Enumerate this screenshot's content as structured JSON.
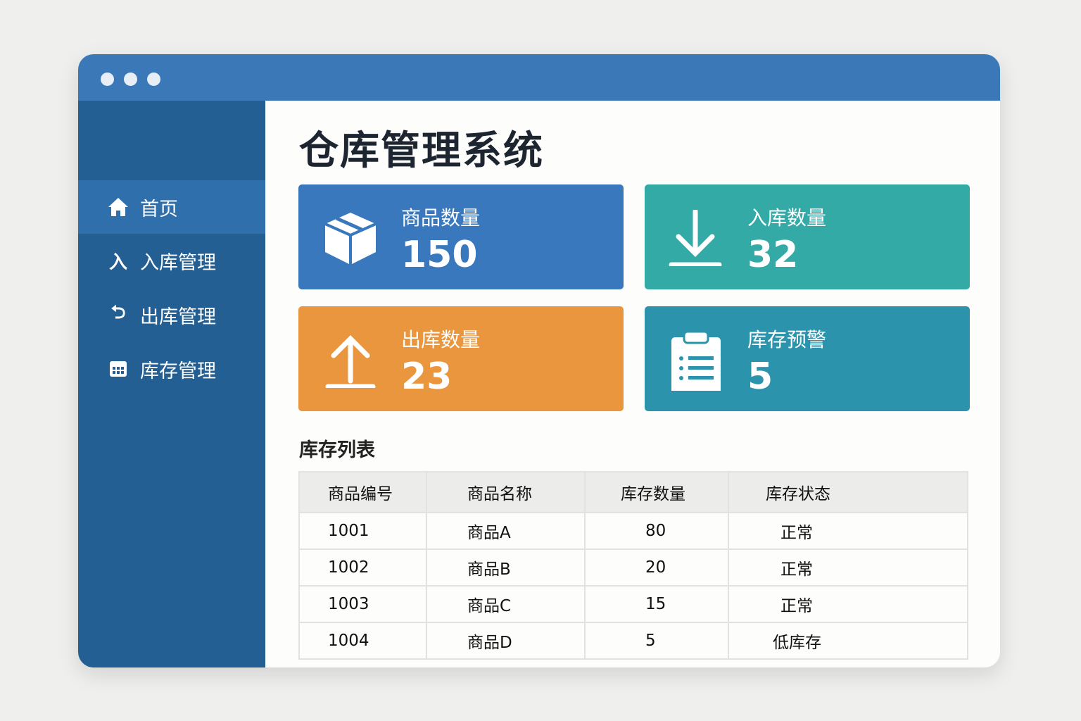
{
  "sidebar": {
    "items": [
      {
        "label": "首页",
        "icon": "home-icon"
      },
      {
        "label": "入库管理",
        "icon": "inbound-icon",
        "glyph": "入"
      },
      {
        "label": "出库管理",
        "icon": "outbound-icon",
        "glyph": "⮌"
      },
      {
        "label": "库存管理",
        "icon": "grid-icon"
      }
    ]
  },
  "main": {
    "title": "仓库管理系统",
    "cards": [
      {
        "label": "商品数量",
        "value": "150",
        "color": "#3a78bd"
      },
      {
        "label": "入库数量",
        "value": "32",
        "color": "#33aaa6"
      },
      {
        "label": "出库数量",
        "value": "23",
        "color": "#ea963f"
      },
      {
        "label": "库存预警",
        "value": "5",
        "color": "#2c93ac"
      }
    ],
    "section_title": "库存列表",
    "table": {
      "headers": [
        "商品编号",
        "商品名称",
        "库存数量",
        "库存状态"
      ],
      "rows": [
        [
          "1001",
          "商品A",
          "80",
          "正常"
        ],
        [
          "1002",
          "商品B",
          "20",
          "正常"
        ],
        [
          "1003",
          "商品C",
          "15",
          "正常"
        ],
        [
          "1004",
          "商品D",
          "5",
          "低库存"
        ]
      ]
    }
  }
}
